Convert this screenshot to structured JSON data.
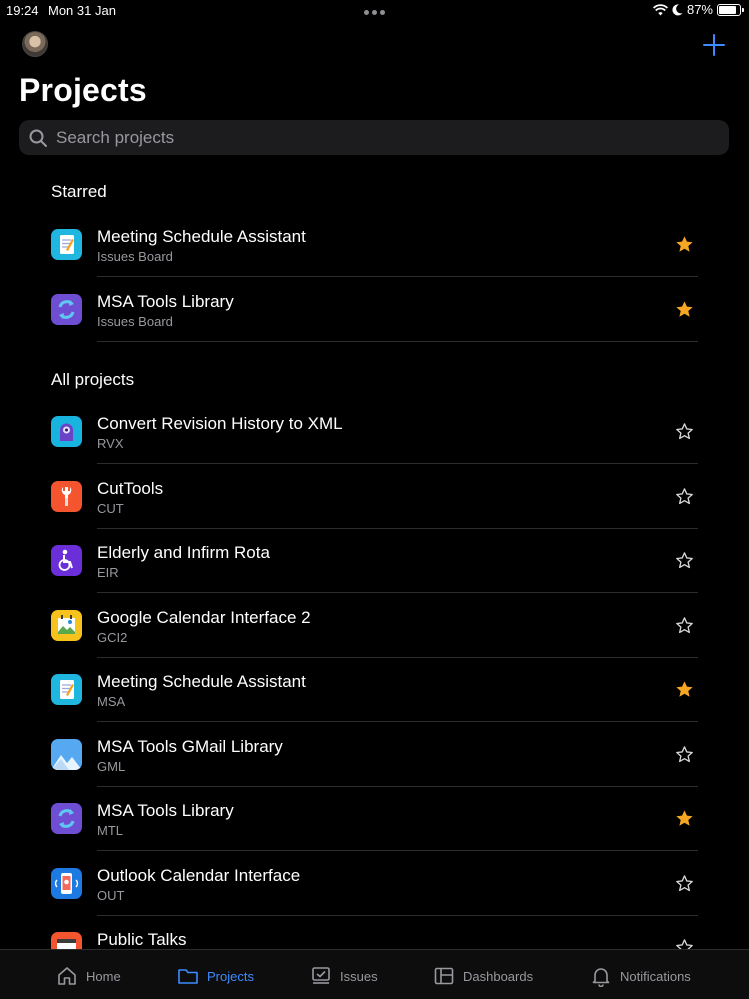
{
  "status": {
    "time": "19:24",
    "date": "Mon 31 Jan",
    "battery": "87%",
    "battery_level": 0.87
  },
  "header": {
    "title": "Projects"
  },
  "search": {
    "placeholder": "Search projects"
  },
  "sections": {
    "starred": "Starred",
    "all": "All projects"
  },
  "starred": [
    {
      "name": "Meeting Schedule Assistant",
      "sub": "Issues Board",
      "icon": "notepad-icon",
      "starred": true
    },
    {
      "name": "MSA Tools Library",
      "sub": "Issues Board",
      "icon": "sync-icon",
      "starred": true
    }
  ],
  "projects": [
    {
      "name": "Convert Revision History to XML",
      "sub": "RVX",
      "icon": "robot-icon",
      "starred": false
    },
    {
      "name": "CutTools",
      "sub": "CUT",
      "icon": "wrench-icon",
      "starred": false
    },
    {
      "name": "Elderly and Infirm Rota",
      "sub": "EIR",
      "icon": "wheelchair-icon",
      "starred": false
    },
    {
      "name": "Google Calendar Interface 2",
      "sub": "GCI2",
      "icon": "calendar-picture-icon",
      "starred": false
    },
    {
      "name": "Meeting Schedule Assistant",
      "sub": "MSA",
      "icon": "notepad-icon",
      "starred": true
    },
    {
      "name": "MSA Tools GMail Library",
      "sub": "GML",
      "icon": "mountain-icon",
      "starred": false
    },
    {
      "name": "MSA Tools Library",
      "sub": "MTL",
      "icon": "sync-icon",
      "starred": true
    },
    {
      "name": "Outlook Calendar Interface",
      "sub": "OUT",
      "icon": "phone-icon",
      "starred": false
    },
    {
      "name": "Public Talks",
      "sub": "",
      "icon": "browser-icon",
      "starred": false
    }
  ],
  "tabs": [
    {
      "label": "Home",
      "icon": "home-icon",
      "active": false
    },
    {
      "label": "Projects",
      "icon": "folder-icon",
      "active": true
    },
    {
      "label": "Issues",
      "icon": "issues-icon",
      "active": false
    },
    {
      "label": "Dashboards",
      "icon": "dashboard-icon",
      "active": false
    },
    {
      "label": "Notifications",
      "icon": "bell-icon",
      "active": false
    }
  ],
  "colors": {
    "accent": "#3d8bff",
    "star": "#f5a623",
    "background": "#000000"
  }
}
